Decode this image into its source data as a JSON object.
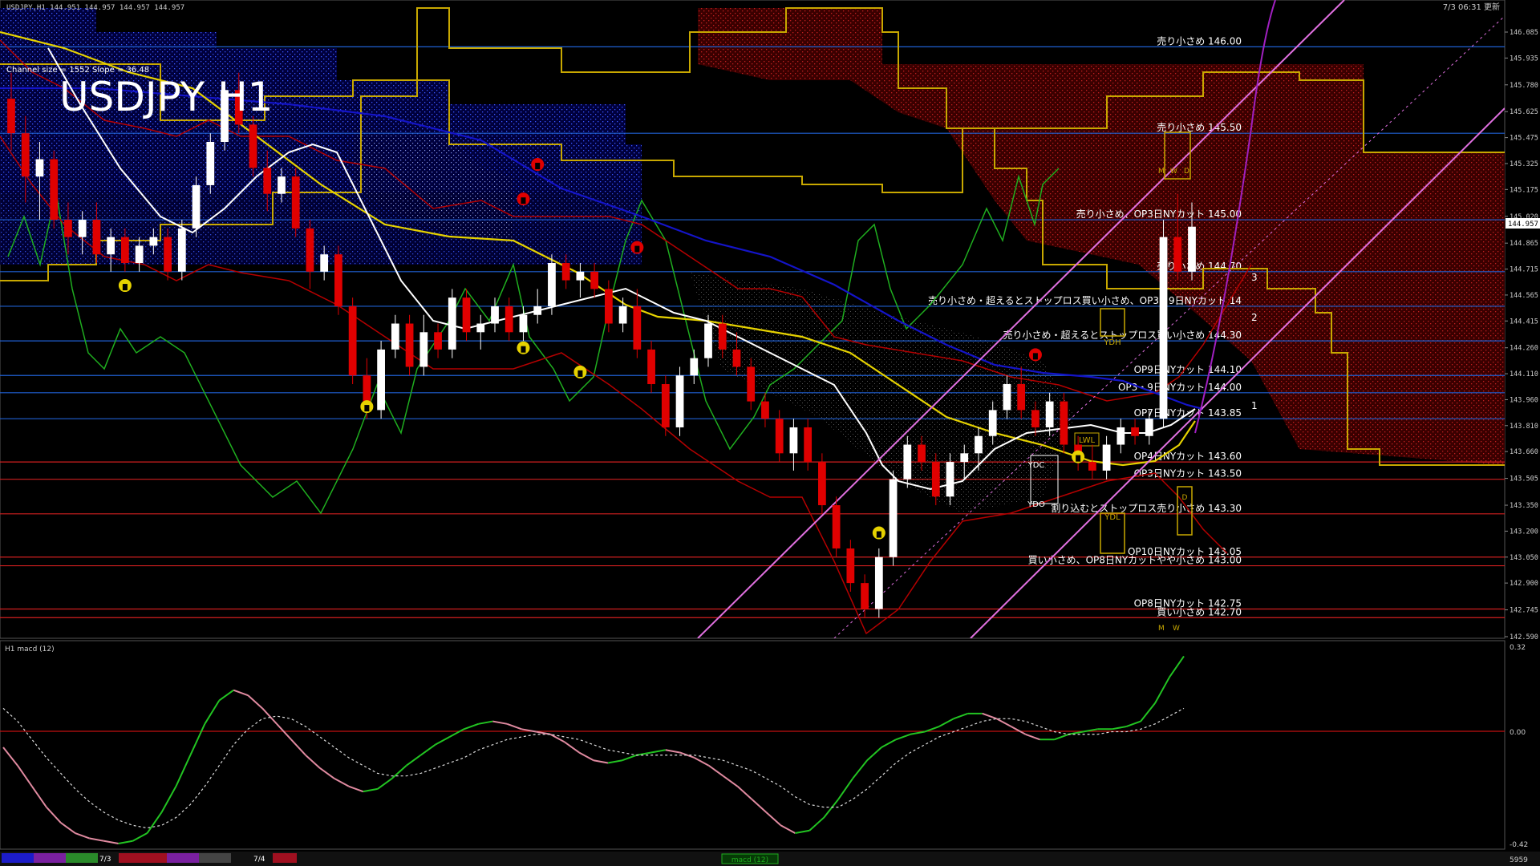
{
  "window": {
    "header_info": "USDJPY,H1  144.951 144.957 144.957 144.957",
    "timestamp": "7/3 06:31 更新",
    "channel_info": "Channel size = 1552  Slope = 36.48",
    "symbol_title": "USDJPY H1"
  },
  "colors": {
    "background": "#000000",
    "grid_blue": "#1f5fd1",
    "grid_red": "#d11f1f",
    "candle_up": "#ffffff",
    "candle_down": "#e00000",
    "ma_white": "#ffffff",
    "ma_yellow": "#e6d200",
    "ma_blue": "#1414c8",
    "chikou_green": "#1fae1f",
    "bollinger_red": "#b40000",
    "cloud_gold": "#c8a800",
    "channel_pink": "#e070e0",
    "macd_green": "#22c422",
    "macd_pink": "#e08aa0"
  },
  "price_axis": {
    "min": 142.59,
    "max": 146.085,
    "ticks": [
      "146.085",
      "145.935",
      "145.780",
      "145.625",
      "145.475",
      "145.325",
      "145.175",
      "145.020",
      "144.865",
      "144.715",
      "144.565",
      "144.415",
      "144.260",
      "144.110",
      "143.960",
      "143.810",
      "143.660",
      "143.505",
      "143.350",
      "143.200",
      "143.050",
      "142.900",
      "142.745",
      "142.590"
    ],
    "current_price": "144.957"
  },
  "levels": [
    {
      "price": 146.0,
      "label": "売り小さめ 146.00",
      "kind": "blue"
    },
    {
      "price": 145.5,
      "label": "売り小さめ 145.50",
      "kind": "blue"
    },
    {
      "price": 145.0,
      "label": "売り小さめ、OP3日NYカット 145.00",
      "kind": "blue"
    },
    {
      "price": 144.7,
      "label": "売り小さめ 144.70",
      "kind": "blue"
    },
    {
      "price": 144.5,
      "label": "売り小さめ・超えるとストップロス買い小さめ、OP3・9日NYカット 14",
      "kind": "blue"
    },
    {
      "price": 144.3,
      "label": "売り小さめ・超えるとストップロス買い小さめ 144.30",
      "kind": "blue"
    },
    {
      "price": 144.1,
      "label": "OP9日NYカット 144.10",
      "kind": "blue"
    },
    {
      "price": 144.0,
      "label": "OP3・9日NYカット 144.00",
      "kind": "blue"
    },
    {
      "price": 143.85,
      "label": "OP7日NYカット 143.85",
      "kind": "blue"
    },
    {
      "price": 143.6,
      "label": "OP4日NYカット 143.60",
      "kind": "red"
    },
    {
      "price": 143.5,
      "label": "OP3日NYカット 143.50",
      "kind": "red"
    },
    {
      "price": 143.3,
      "label": "割り込むとストップロス売り小さめ 143.30",
      "kind": "red"
    },
    {
      "price": 143.05,
      "label": "OP10日NYカット 143.05",
      "kind": "red"
    },
    {
      "price": 143.0,
      "label": "買い小さめ、OP8日NYカットやや小さめ 143.00",
      "kind": "red"
    },
    {
      "price": 142.75,
      "label": "OP8日NYカット 142.75",
      "kind": "red"
    },
    {
      "price": 142.7,
      "label": "買い小さめ 142.70",
      "kind": "red"
    }
  ],
  "channel_markers": [
    "3",
    "2",
    "1"
  ],
  "box_labels": {
    "ydh": "YDH",
    "ydc": "YDC",
    "ydo": "YDO",
    "ydl": "YDL",
    "lwl": "LWL",
    "d_top": "D",
    "d_bottom": "D",
    "m_top": "M",
    "w_top": "W",
    "m_bottom": "M",
    "w_bottom": "W"
  },
  "macd": {
    "title": "H1  macd (12)",
    "ticks": [
      "0.32",
      "0.00",
      "-0.42"
    ],
    "min": -0.42,
    "max": 0.32
  },
  "bottom_bar": {
    "date_labels": [
      "7/3",
      "7/4"
    ],
    "tab_label": "macd (12)",
    "right_value": "5959"
  },
  "chart_data": {
    "type": "candlestick",
    "title": "USDJPY H1",
    "ylim": [
      142.59,
      146.085
    ],
    "candles": [
      {
        "o": 145.7,
        "h": 145.85,
        "l": 145.4,
        "c": 145.5
      },
      {
        "o": 145.5,
        "h": 145.6,
        "l": 145.1,
        "c": 145.25
      },
      {
        "o": 145.25,
        "h": 145.45,
        "l": 145.0,
        "c": 145.35
      },
      {
        "o": 145.35,
        "h": 145.4,
        "l": 144.95,
        "c": 145.0
      },
      {
        "o": 145.0,
        "h": 145.1,
        "l": 144.8,
        "c": 144.9
      },
      {
        "o": 144.9,
        "h": 145.05,
        "l": 144.8,
        "c": 145.0
      },
      {
        "o": 145.0,
        "h": 145.1,
        "l": 144.75,
        "c": 144.8
      },
      {
        "o": 144.8,
        "h": 144.95,
        "l": 144.7,
        "c": 144.9
      },
      {
        "o": 144.9,
        "h": 144.95,
        "l": 144.7,
        "c": 144.75
      },
      {
        "o": 144.75,
        "h": 144.9,
        "l": 144.7,
        "c": 144.85
      },
      {
        "o": 144.85,
        "h": 144.95,
        "l": 144.8,
        "c": 144.9
      },
      {
        "o": 144.9,
        "h": 144.95,
        "l": 144.65,
        "c": 144.7
      },
      {
        "o": 144.7,
        "h": 145.0,
        "l": 144.65,
        "c": 144.95
      },
      {
        "o": 144.95,
        "h": 145.25,
        "l": 144.9,
        "c": 145.2
      },
      {
        "o": 145.2,
        "h": 145.5,
        "l": 145.15,
        "c": 145.45
      },
      {
        "o": 145.45,
        "h": 145.8,
        "l": 145.4,
        "c": 145.75
      },
      {
        "o": 145.75,
        "h": 145.85,
        "l": 145.5,
        "c": 145.55
      },
      {
        "o": 145.55,
        "h": 145.6,
        "l": 145.25,
        "c": 145.3
      },
      {
        "o": 145.3,
        "h": 145.4,
        "l": 145.05,
        "c": 145.15
      },
      {
        "o": 145.15,
        "h": 145.3,
        "l": 145.1,
        "c": 145.25
      },
      {
        "o": 145.25,
        "h": 145.3,
        "l": 144.9,
        "c": 144.95
      },
      {
        "o": 144.95,
        "h": 145.0,
        "l": 144.6,
        "c": 144.7
      },
      {
        "o": 144.7,
        "h": 144.85,
        "l": 144.65,
        "c": 144.8
      },
      {
        "o": 144.8,
        "h": 144.85,
        "l": 144.45,
        "c": 144.5
      },
      {
        "o": 144.5,
        "h": 144.55,
        "l": 144.05,
        "c": 144.1
      },
      {
        "o": 144.1,
        "h": 144.2,
        "l": 143.85,
        "c": 143.9
      },
      {
        "o": 143.9,
        "h": 144.3,
        "l": 143.85,
        "c": 144.25
      },
      {
        "o": 144.25,
        "h": 144.45,
        "l": 144.2,
        "c": 144.4
      },
      {
        "o": 144.4,
        "h": 144.45,
        "l": 144.1,
        "c": 144.15
      },
      {
        "o": 144.15,
        "h": 144.45,
        "l": 144.1,
        "c": 144.35
      },
      {
        "o": 144.35,
        "h": 144.4,
        "l": 144.2,
        "c": 144.25
      },
      {
        "o": 144.25,
        "h": 144.6,
        "l": 144.2,
        "c": 144.55
      },
      {
        "o": 144.55,
        "h": 144.6,
        "l": 144.3,
        "c": 144.35
      },
      {
        "o": 144.35,
        "h": 144.45,
        "l": 144.25,
        "c": 144.4
      },
      {
        "o": 144.4,
        "h": 144.55,
        "l": 144.35,
        "c": 144.5
      },
      {
        "o": 144.5,
        "h": 144.55,
        "l": 144.3,
        "c": 144.35
      },
      {
        "o": 144.35,
        "h": 144.5,
        "l": 144.3,
        "c": 144.45
      },
      {
        "o": 144.45,
        "h": 144.6,
        "l": 144.4,
        "c": 144.5
      },
      {
        "o": 144.5,
        "h": 144.8,
        "l": 144.45,
        "c": 144.75
      },
      {
        "o": 144.75,
        "h": 144.8,
        "l": 144.6,
        "c": 144.65
      },
      {
        "o": 144.65,
        "h": 144.75,
        "l": 144.55,
        "c": 144.7
      },
      {
        "o": 144.7,
        "h": 144.75,
        "l": 144.55,
        "c": 144.6
      },
      {
        "o": 144.6,
        "h": 144.65,
        "l": 144.35,
        "c": 144.4
      },
      {
        "o": 144.4,
        "h": 144.55,
        "l": 144.35,
        "c": 144.5
      },
      {
        "o": 144.5,
        "h": 144.6,
        "l": 144.2,
        "c": 144.25
      },
      {
        "o": 144.25,
        "h": 144.3,
        "l": 144.0,
        "c": 144.05
      },
      {
        "o": 144.05,
        "h": 144.1,
        "l": 143.75,
        "c": 143.8
      },
      {
        "o": 143.8,
        "h": 144.15,
        "l": 143.75,
        "c": 144.1
      },
      {
        "o": 144.1,
        "h": 144.25,
        "l": 144.05,
        "c": 144.2
      },
      {
        "o": 144.2,
        "h": 144.45,
        "l": 144.15,
        "c": 144.4
      },
      {
        "o": 144.4,
        "h": 144.45,
        "l": 144.2,
        "c": 144.25
      },
      {
        "o": 144.25,
        "h": 144.35,
        "l": 144.1,
        "c": 144.15
      },
      {
        "o": 144.15,
        "h": 144.2,
        "l": 143.9,
        "c": 143.95
      },
      {
        "o": 143.95,
        "h": 144.0,
        "l": 143.8,
        "c": 143.85
      },
      {
        "o": 143.85,
        "h": 143.9,
        "l": 143.6,
        "c": 143.65
      },
      {
        "o": 143.65,
        "h": 143.85,
        "l": 143.55,
        "c": 143.8
      },
      {
        "o": 143.8,
        "h": 143.85,
        "l": 143.55,
        "c": 143.6
      },
      {
        "o": 143.6,
        "h": 143.65,
        "l": 143.3,
        "c": 143.35
      },
      {
        "o": 143.35,
        "h": 143.4,
        "l": 143.05,
        "c": 143.1
      },
      {
        "o": 143.1,
        "h": 143.15,
        "l": 142.85,
        "c": 142.9
      },
      {
        "o": 142.9,
        "h": 142.95,
        "l": 142.7,
        "c": 142.75
      },
      {
        "o": 142.75,
        "h": 143.1,
        "l": 142.7,
        "c": 143.05
      },
      {
        "o": 143.05,
        "h": 143.55,
        "l": 143.0,
        "c": 143.5
      },
      {
        "o": 143.5,
        "h": 143.75,
        "l": 143.45,
        "c": 143.7
      },
      {
        "o": 143.7,
        "h": 143.75,
        "l": 143.55,
        "c": 143.6
      },
      {
        "o": 143.6,
        "h": 143.65,
        "l": 143.35,
        "c": 143.4
      },
      {
        "o": 143.4,
        "h": 143.65,
        "l": 143.35,
        "c": 143.6
      },
      {
        "o": 143.6,
        "h": 143.7,
        "l": 143.5,
        "c": 143.65
      },
      {
        "o": 143.65,
        "h": 143.8,
        "l": 143.55,
        "c": 143.75
      },
      {
        "o": 143.75,
        "h": 143.95,
        "l": 143.7,
        "c": 143.9
      },
      {
        "o": 143.9,
        "h": 144.1,
        "l": 143.85,
        "c": 144.05
      },
      {
        "o": 144.05,
        "h": 144.15,
        "l": 143.85,
        "c": 143.9
      },
      {
        "o": 143.9,
        "h": 143.95,
        "l": 143.75,
        "c": 143.8
      },
      {
        "o": 143.8,
        "h": 144.0,
        "l": 143.75,
        "c": 143.95
      },
      {
        "o": 143.95,
        "h": 144.0,
        "l": 143.65,
        "c": 143.7
      },
      {
        "o": 143.7,
        "h": 143.75,
        "l": 143.55,
        "c": 143.6
      },
      {
        "o": 143.6,
        "h": 143.7,
        "l": 143.5,
        "c": 143.55
      },
      {
        "o": 143.55,
        "h": 143.75,
        "l": 143.5,
        "c": 143.7
      },
      {
        "o": 143.7,
        "h": 143.85,
        "l": 143.65,
        "c": 143.8
      },
      {
        "o": 143.8,
        "h": 143.85,
        "l": 143.7,
        "c": 143.75
      },
      {
        "o": 143.75,
        "h": 143.9,
        "l": 143.7,
        "c": 143.85
      },
      {
        "o": 143.85,
        "h": 145.0,
        "l": 143.8,
        "c": 144.9
      },
      {
        "o": 144.9,
        "h": 145.15,
        "l": 144.65,
        "c": 144.7
      },
      {
        "o": 144.7,
        "h": 145.1,
        "l": 144.65,
        "c": 144.96
      }
    ],
    "macd_main": [
      -0.05,
      -0.12,
      -0.2,
      -0.28,
      -0.34,
      -0.38,
      -0.4,
      -0.41,
      -0.42,
      -0.41,
      -0.38,
      -0.3,
      -0.2,
      -0.08,
      0.04,
      0.13,
      0.17,
      0.15,
      0.1,
      0.04,
      -0.02,
      -0.08,
      -0.13,
      -0.17,
      -0.2,
      -0.22,
      -0.21,
      -0.17,
      -0.12,
      -0.08,
      -0.04,
      -0.01,
      0.02,
      0.04,
      0.05,
      0.04,
      0.02,
      0.01,
      0.0,
      -0.03,
      -0.07,
      -0.1,
      -0.11,
      -0.1,
      -0.08,
      -0.07,
      -0.06,
      -0.07,
      -0.09,
      -0.12,
      -0.16,
      -0.2,
      -0.25,
      -0.3,
      -0.35,
      -0.38,
      -0.37,
      -0.32,
      -0.25,
      -0.17,
      -0.1,
      -0.05,
      -0.02,
      0.0,
      0.01,
      0.03,
      0.06,
      0.08,
      0.08,
      0.06,
      0.03,
      0.0,
      -0.02,
      -0.02,
      0.0,
      0.01,
      0.02,
      0.02,
      0.03,
      0.05,
      0.12,
      0.22,
      0.3
    ],
    "macd_signal": [
      0.1,
      0.05,
      -0.02,
      -0.09,
      -0.15,
      -0.21,
      -0.26,
      -0.3,
      -0.33,
      -0.35,
      -0.36,
      -0.35,
      -0.32,
      -0.27,
      -0.2,
      -0.12,
      -0.04,
      0.02,
      0.06,
      0.07,
      0.06,
      0.03,
      -0.01,
      -0.05,
      -0.09,
      -0.12,
      -0.15,
      -0.16,
      -0.16,
      -0.15,
      -0.13,
      -0.11,
      -0.09,
      -0.06,
      -0.04,
      -0.02,
      -0.01,
      0.0,
      0.0,
      -0.01,
      -0.02,
      -0.04,
      -0.06,
      -0.07,
      -0.08,
      -0.08,
      -0.08,
      -0.08,
      -0.08,
      -0.09,
      -0.1,
      -0.12,
      -0.14,
      -0.17,
      -0.2,
      -0.24,
      -0.27,
      -0.28,
      -0.28,
      -0.25,
      -0.21,
      -0.16,
      -0.11,
      -0.07,
      -0.04,
      -0.01,
      0.01,
      0.03,
      0.05,
      0.06,
      0.06,
      0.05,
      0.03,
      0.01,
      0.0,
      0.0,
      0.0,
      0.01,
      0.01,
      0.02,
      0.04,
      0.07,
      0.1
    ]
  }
}
